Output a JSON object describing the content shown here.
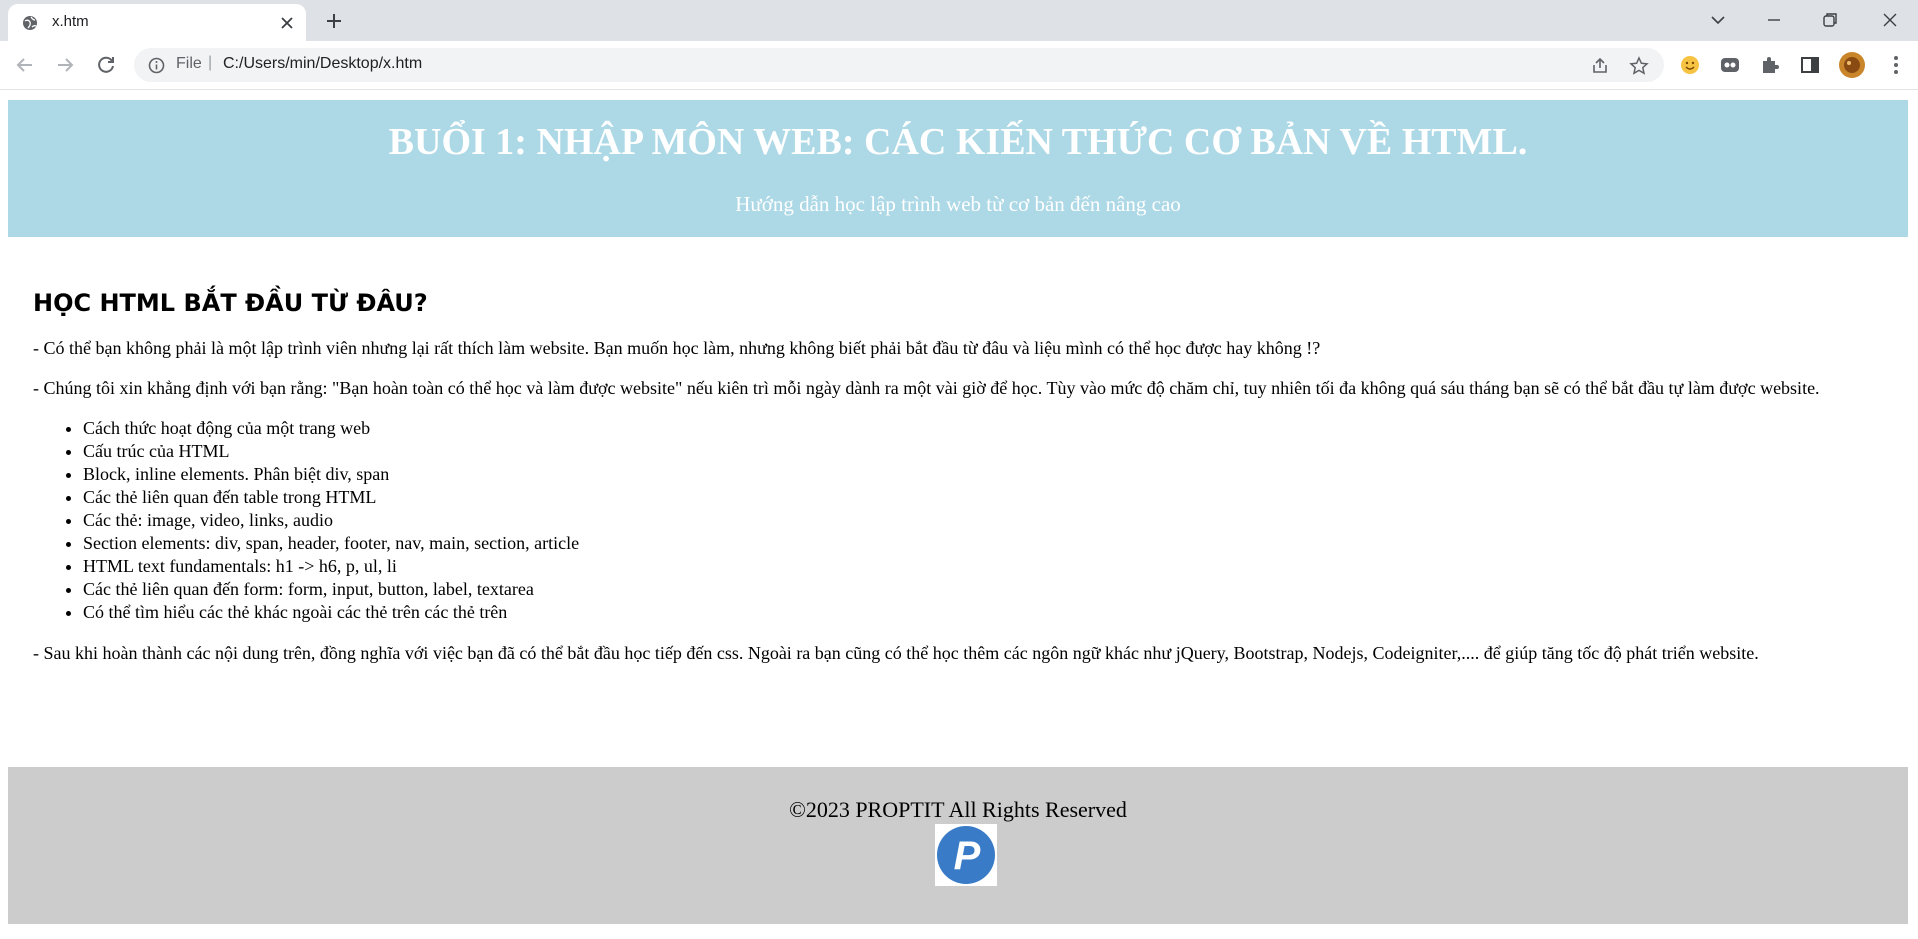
{
  "browser": {
    "tab": {
      "title": "x.htm"
    },
    "address": {
      "scheme": "File",
      "separator": "|",
      "url": "C:/Users/min/Desktop/x.htm"
    }
  },
  "header": {
    "title": "BUỔI 1: NHẬP MÔN WEB: CÁC KIẾN THỨC CƠ BẢN VỀ HTML.",
    "subtitle": "Hướng dẫn học lập trình web từ cơ bản đến nâng cao"
  },
  "main": {
    "heading": "HỌC HTML BẮT ĐẦU TỪ ĐÂU?",
    "p1": "- Có thể bạn không phải là một lập trình viên nhưng lại rất thích làm website. Bạn muốn học làm, nhưng không biết phải bắt đầu từ đâu và liệu mình có thể học được hay không !?",
    "p2": "- Chúng tôi xin khẳng định với bạn rằng: \"Bạn hoàn toàn có thể học và làm được website\" nếu kiên trì mỗi ngày dành ra một vài giờ để học. Tùy vào mức độ chăm chỉ, tuy nhiên tối đa không quá sáu tháng bạn sẽ có thể bắt đầu tự làm được website.",
    "items": [
      "Cách thức hoạt động của một trang web",
      "Cấu trúc của HTML",
      "Block, inline elements. Phân biệt div, span",
      "Các thẻ liên quan đến table trong HTML",
      "Các thẻ: image, video, links, audio",
      "Section elements: div, span, header, footer, nav, main, section, article",
      "HTML text fundamentals: h1 -> h6, p, ul, li",
      "Các thẻ liên quan đến form: form, input, button, label, textarea",
      "Có thể tìm hiểu các thẻ khác ngoài các thẻ trên các thẻ trên"
    ],
    "p3": "- Sau khi hoàn thành các nội dung trên, đồng nghĩa với việc bạn đã có thể bắt đầu học tiếp đến css. Ngoài ra bạn cũng có thể học thêm các ngôn ngữ khác như jQuery, Bootstrap, Nodejs, Codeigniter,.... để giúp tăng tốc độ phát triển website."
  },
  "footer": {
    "copyright": "©2023 PROPTIT All Rights Reserved",
    "logo_letter": "P"
  },
  "colors": {
    "header_bg": "#add8e6",
    "footer_bg": "#cccccc",
    "logo_blue": "#3a7bc8"
  },
  "icons": [
    "globe-icon",
    "close-icon",
    "plus-icon",
    "chevron-down-icon",
    "minimize-icon",
    "restore-icon",
    "window-close-icon",
    "back-icon",
    "forward-icon",
    "reload-icon",
    "info-icon",
    "share-icon",
    "star-icon",
    "emoji-extension-icon",
    "extension-icon",
    "puzzle-icon",
    "side-panel-icon",
    "profile-avatar",
    "kebab-menu-icon"
  ]
}
